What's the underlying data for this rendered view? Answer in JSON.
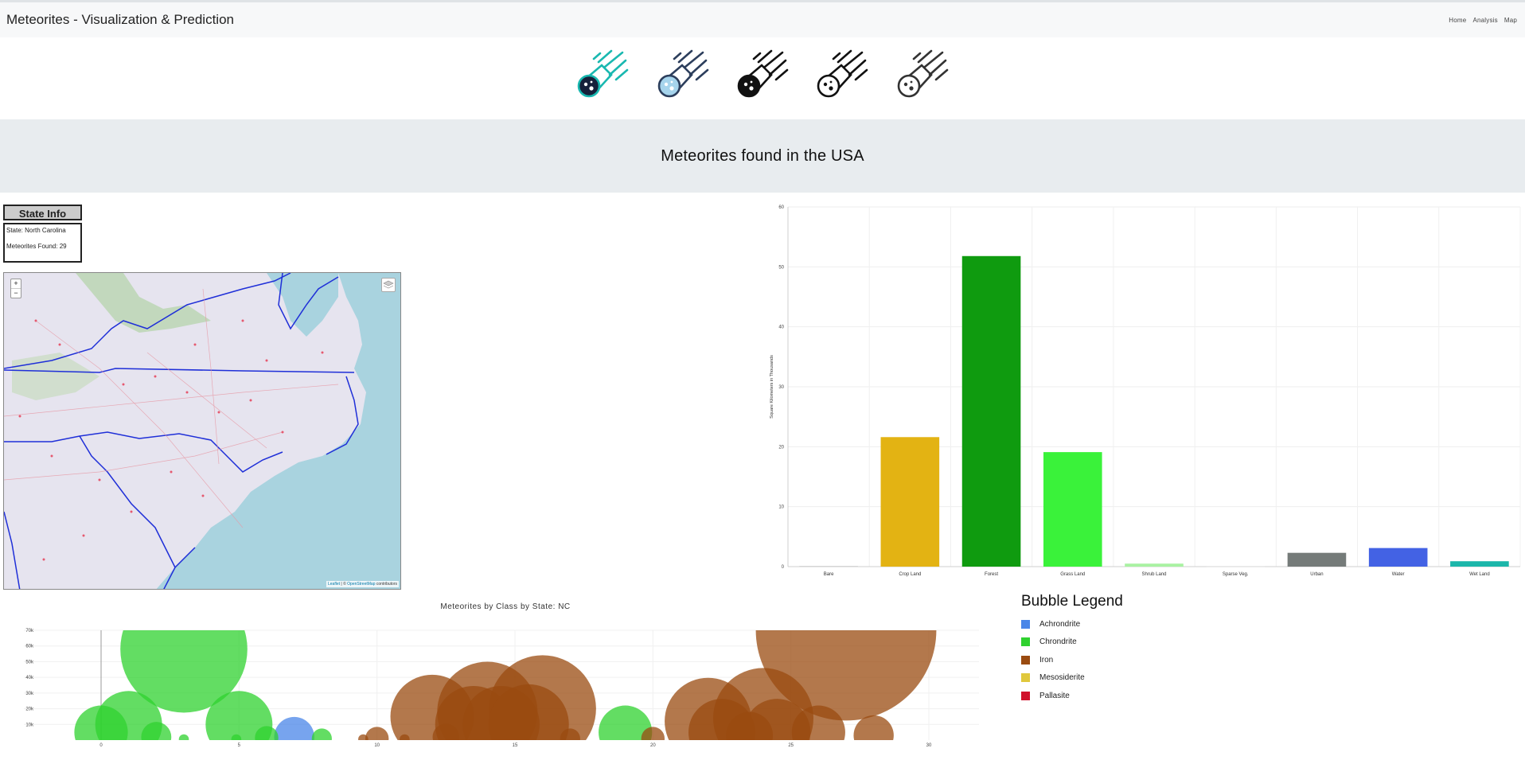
{
  "app": {
    "title": "Meteorites - Visualization & Prediction",
    "nav": [
      "Home",
      "Analysis",
      "Map"
    ]
  },
  "icons": [
    {
      "name": "meteor-teal-icon",
      "color": "#19b8b0",
      "fill": "#16203a"
    },
    {
      "name": "meteor-blue-icon",
      "color": "#2c3e5c",
      "fill": "#a6d4ec"
    },
    {
      "name": "meteor-black-icon",
      "color": "#111111",
      "fill": "#111111"
    },
    {
      "name": "meteor-outline-icon",
      "color": "#111111",
      "fill": "#ffffff"
    },
    {
      "name": "meteor-light-icon",
      "color": "#333333",
      "fill": "#ffffff"
    }
  ],
  "header": {
    "title": "Meteorites found in the USA"
  },
  "state_info": {
    "title": "State Info",
    "state_line": "State: North Carolina",
    "count_line": "Meteorites Found: 29"
  },
  "map": {
    "zoom_in": "+",
    "zoom_out": "−",
    "attribution_leaflet": "Leaflet",
    "attribution_sep": " | © ",
    "attribution_osm": "OpenStreetMap",
    "attribution_tail": " contributors"
  },
  "chart_data": [
    {
      "type": "bar",
      "categories": [
        "Bare",
        "Crop Land",
        "Forest",
        "Grass Land",
        "Shrub Land",
        "Sparse Veg.",
        "Urban",
        "Water",
        "Wet Land"
      ],
      "values": [
        0.1,
        21.6,
        51.8,
        19.1,
        0.5,
        0.05,
        2.3,
        3.1,
        0.9
      ],
      "colors": [
        "#c8c8c8",
        "#e3b313",
        "#0f9b0f",
        "#3af23a",
        "#a9f2a2",
        "#d8d8d8",
        "#757b79",
        "#4362e4",
        "#1cb6aa"
      ],
      "ylabel": "Square Kilometers in Thousands",
      "ylim": [
        0,
        60
      ],
      "yticks": [
        0,
        10,
        20,
        30,
        40,
        50,
        60
      ],
      "grid": true
    },
    {
      "type": "scatter",
      "title": "Meteorites by Class by State: NC",
      "xlim": [
        0,
        30
      ],
      "xticks": [
        0,
        5,
        10,
        15,
        20,
        25,
        30
      ],
      "ylim": [
        0,
        70000
      ],
      "yticks": [
        10000,
        20000,
        30000,
        40000,
        50000,
        60000,
        70000
      ],
      "yticklabels": [
        "10k",
        "20k",
        "30k",
        "40k",
        "50k",
        "60k",
        "70k"
      ],
      "grid": true,
      "legend_title": "Bubble Legend",
      "series": [
        {
          "name": "Achrondrite",
          "color": "#4a86e8",
          "points": [
            [
              7,
              2000,
              0.6
            ]
          ]
        },
        {
          "name": "Chrondrite",
          "color": "#2fd12f",
          "points": [
            [
              0,
              5000,
              0.8
            ],
            [
              1,
              10000,
              1.0
            ],
            [
              2,
              2000,
              0.45
            ],
            [
              3,
              58000,
              1.9
            ],
            [
              5,
              10000,
              1.0
            ],
            [
              6,
              1500,
              0.35
            ],
            [
              8,
              1000,
              0.3
            ],
            [
              19,
              5000,
              0.8
            ],
            [
              3.0,
              500,
              0.15
            ],
            [
              4.9,
              500,
              0.15
            ]
          ]
        },
        {
          "name": "Iron",
          "color": "#9a4b10",
          "points": [
            [
              10,
              1000,
              0.35
            ],
            [
              12,
              15000,
              1.25
            ],
            [
              12.5,
              2000,
              0.4
            ],
            [
              14,
              18000,
              1.5
            ],
            [
              13.5,
              10000,
              1.15
            ],
            [
              14.5,
              10000,
              1.15
            ],
            [
              16,
              20000,
              1.6
            ],
            [
              15.5,
              10000,
              1.2
            ],
            [
              17,
              1000,
              0.3
            ],
            [
              20,
              1000,
              0.35
            ],
            [
              22,
              12000,
              1.3
            ],
            [
              22.5,
              5000,
              1.0
            ],
            [
              24,
              14000,
              1.5
            ],
            [
              24.5,
              5000,
              1.0
            ],
            [
              26,
              5000,
              0.8
            ],
            [
              27,
              70000,
              2.7
            ],
            [
              28,
              3000,
              0.6
            ],
            [
              23.5,
              3000,
              0.7
            ],
            [
              9.5,
              500,
              0.15
            ],
            [
              11,
              500,
              0.15
            ]
          ]
        },
        {
          "name": "Mesosiderite",
          "color": "#e0c83c",
          "points": []
        },
        {
          "name": "Pallasite",
          "color": "#d0112b",
          "points": []
        }
      ]
    }
  ]
}
